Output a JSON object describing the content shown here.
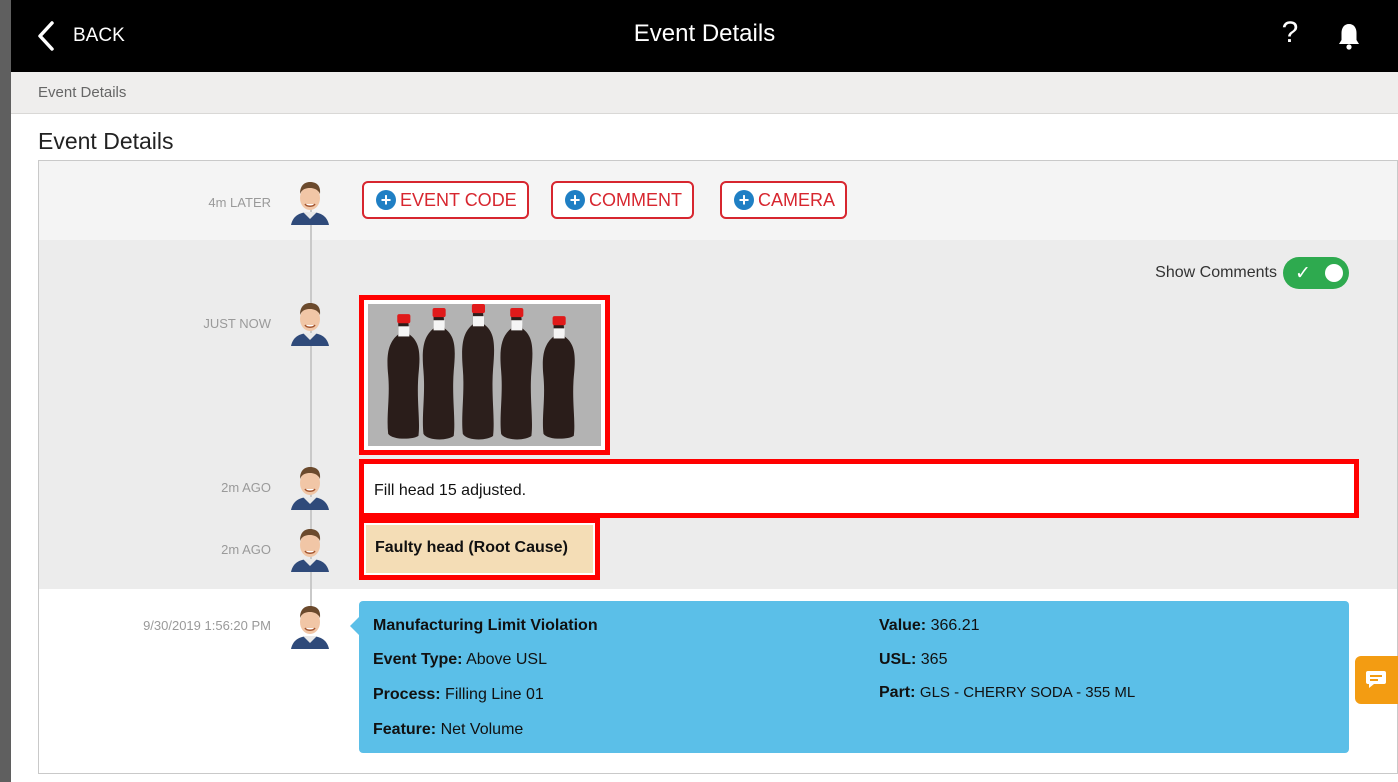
{
  "topbar": {
    "back_label": "BACK",
    "title": "Event Details",
    "help_label": "?"
  },
  "breadcrumb": {
    "label": "Event Details"
  },
  "page": {
    "title": "Event Details"
  },
  "actions": {
    "time": "4m LATER",
    "buttons": [
      {
        "label": "EVENT CODE"
      },
      {
        "label": "COMMENT"
      },
      {
        "label": "CAMERA"
      }
    ]
  },
  "show_comments": {
    "label": "Show Comments",
    "enabled": true
  },
  "timeline": [
    {
      "time": "JUST NOW",
      "type": "image"
    },
    {
      "time": "2m AGO",
      "type": "comment",
      "text": "Fill head 15 adjusted."
    },
    {
      "time": "2m AGO",
      "type": "event_code",
      "text": "Faulty head (Root Cause)"
    }
  ],
  "event": {
    "time": "9/30/2019 1:56:20 PM",
    "title": "Manufacturing Limit Violation",
    "event_type_label": "Event Type:",
    "event_type": "Above USL",
    "process_label": "Process:",
    "process": "Filling Line 01",
    "feature_label": "Feature:",
    "feature": "Net Volume",
    "value_label": "Value:",
    "value": "366.21",
    "usl_label": "USL:",
    "usl": "365",
    "part_label": "Part:",
    "part": "GLS - CHERRY SODA - 355 ML"
  },
  "colors": {
    "accent_red": "#d7262f",
    "plus_blue": "#1f7fc4",
    "toggle_green": "#2eaa4f",
    "event_blue": "#5bbfe8",
    "code_tan": "#f4ddb6",
    "chat_orange": "#f39c12"
  },
  "icons": {
    "back": "chevron-left-icon",
    "help": "question-icon",
    "notifications": "bell-icon",
    "add": "plus-circle-icon",
    "chat": "chat-icon"
  }
}
